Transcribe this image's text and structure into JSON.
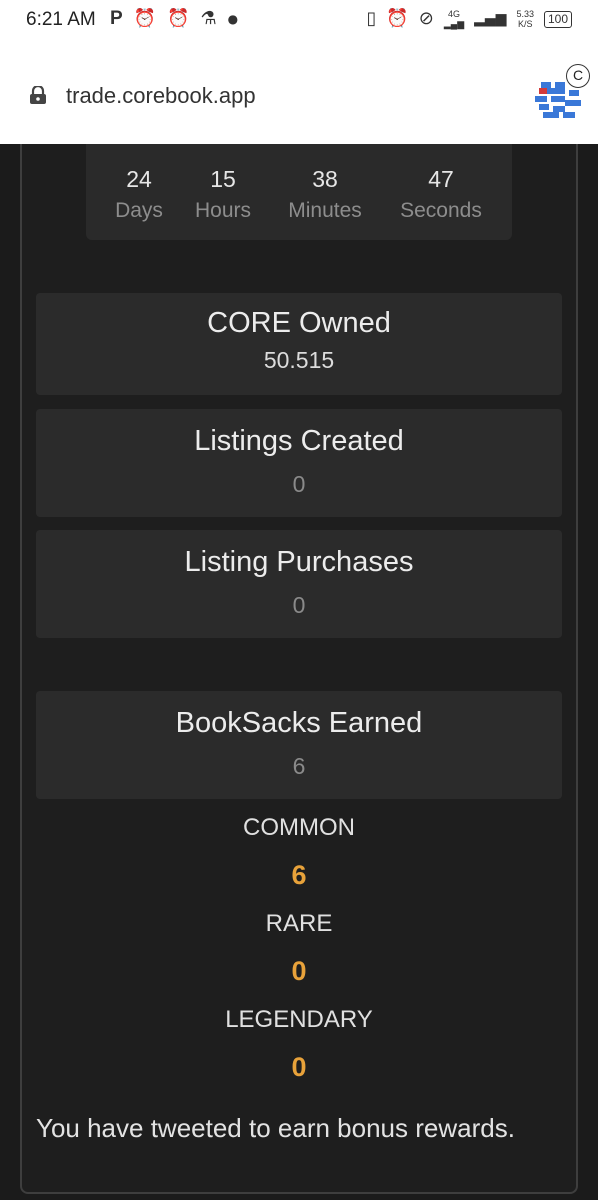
{
  "status_bar": {
    "time": "6:21 AM",
    "left_icons": [
      "p-icon",
      "alarm-icon",
      "alarm-icon",
      "flask-icon",
      "dot-icon"
    ],
    "right_icons": [
      "vibrate-icon",
      "alarm-icon",
      "do-not-disturb-icon",
      "signal-4g-icon",
      "signal-icon"
    ],
    "network": "4G",
    "speed_value": "5.33",
    "speed_unit": "K/S",
    "battery": "100"
  },
  "browser": {
    "url": "trade.corebook.app",
    "avatar_badge": "C"
  },
  "countdown": {
    "units": [
      {
        "value": "24",
        "label": "Days"
      },
      {
        "value": "15",
        "label": "Hours"
      },
      {
        "value": "38",
        "label": "Minutes"
      },
      {
        "value": "47",
        "label": "Seconds"
      }
    ]
  },
  "stats": {
    "core_owned": {
      "title": "CORE Owned",
      "value": "50.515"
    },
    "listings_created": {
      "title": "Listings Created",
      "value": "0"
    },
    "listing_purchases": {
      "title": "Listing Purchases",
      "value": "0"
    },
    "booksacks_earned": {
      "title": "BookSacks Earned",
      "value": "6"
    }
  },
  "tiers": [
    {
      "label": "COMMON",
      "value": "6"
    },
    {
      "label": "RARE",
      "value": "0"
    },
    {
      "label": "LEGENDARY",
      "value": "0"
    }
  ],
  "tweet_note": "You have tweeted to earn bonus rewards.",
  "colors": {
    "page_bg": "#1e1e1e",
    "card_bg": "#2b2b2b",
    "accent": "#e8a23a"
  }
}
